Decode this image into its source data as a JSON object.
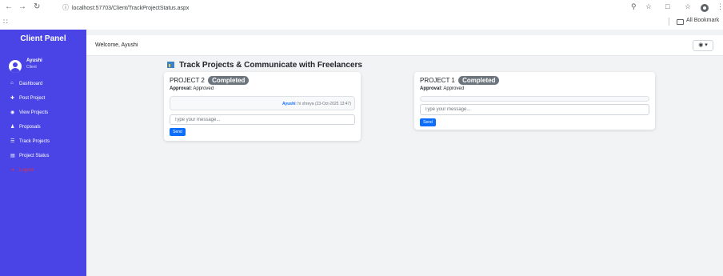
{
  "browser": {
    "url": "localhost:57703/Client/TrackProjectStatus.aspx",
    "bookmarks_label": "All Bookmark"
  },
  "sidebar": {
    "title": "Client Panel",
    "user_name": "Ayushi",
    "user_role": "Client",
    "items": [
      {
        "label": "Dashboard",
        "icon": "home-icon"
      },
      {
        "label": "Post Project",
        "icon": "plus-icon"
      },
      {
        "label": "View Projects",
        "icon": "eye-icon"
      },
      {
        "label": "Proposals",
        "icon": "user-icon"
      },
      {
        "label": "Track Projects",
        "icon": "list-icon"
      },
      {
        "label": "Project Status",
        "icon": "status-icon"
      },
      {
        "label": "Logout",
        "icon": "logout-icon"
      }
    ]
  },
  "header": {
    "welcome": "Welcome, Ayushi"
  },
  "main": {
    "title": "Track Projects & Communicate with Freelancers"
  },
  "projects": [
    {
      "title": "PROJECT 2",
      "status": "Completed",
      "approval_label": "Approval:",
      "approval_value": "Approved",
      "messages": [
        {
          "sender": "Ayushi",
          "text": ": hi shreya (23-Oct-2025 13:47)"
        }
      ],
      "input_placeholder": "Type your message...",
      "send_label": "Send"
    },
    {
      "title": "PROJECT 1",
      "status": "Completed",
      "approval_label": "Approval:",
      "approval_value": "Approved",
      "messages": [],
      "input_placeholder": "Type your message...",
      "send_label": "Send"
    }
  ],
  "colors": {
    "sidebar": "#4a44e6",
    "badge": "#6c757d",
    "primary": "#0d6efd",
    "logout": "#e0324a"
  }
}
